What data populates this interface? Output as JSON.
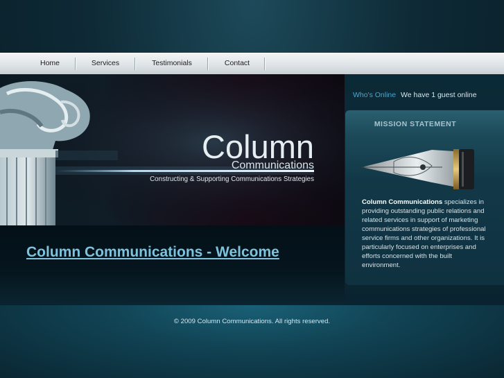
{
  "nav": {
    "items": [
      {
        "label": "Home"
      },
      {
        "label": "Services"
      },
      {
        "label": "Testimonials"
      },
      {
        "label": "Contact"
      }
    ]
  },
  "banner": {
    "title": "Column",
    "subtitle": "Communications",
    "tagline": "Constructing & Supporting Communications Strategies"
  },
  "main": {
    "heading": "Column Communications - Welcome"
  },
  "sidebar": {
    "online_label": "Who's Online",
    "online_text": "We have 1 guest online",
    "mission_title": "MISSION STATEMENT",
    "mission_company": "Column Communications",
    "mission_body": " specializes in providing outstanding public relations and related services in support of marketing communications strategies of professional service firms and other organizations.  It is particularly focused on enterprises and efforts concerned with the built environment."
  },
  "footer": {
    "copyright": "© 2009 Column Communications. All rights reserved."
  },
  "colors": {
    "accent": "#7ec3dd",
    "online_label": "#4aa7d0",
    "background": "#0e2a36"
  }
}
